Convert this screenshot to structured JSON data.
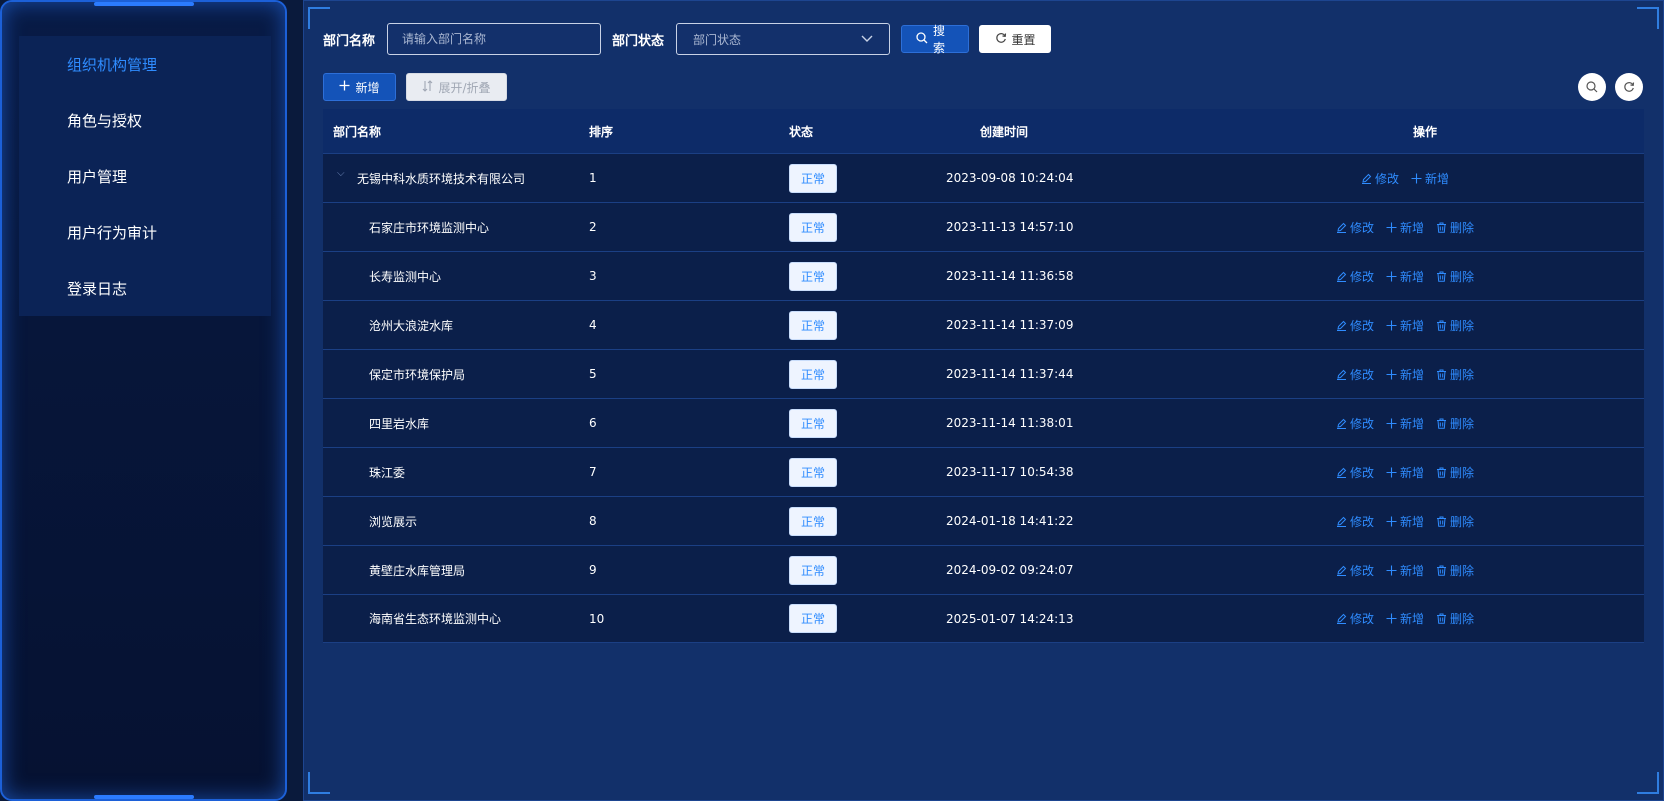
{
  "sidebar": {
    "items": [
      {
        "label": "组织机构管理",
        "active": true
      },
      {
        "label": "角色与授权",
        "active": false
      },
      {
        "label": "用户管理",
        "active": false
      },
      {
        "label": "用户行为审计",
        "active": false
      },
      {
        "label": "登录日志",
        "active": false
      }
    ]
  },
  "search": {
    "name_label": "部门名称",
    "name_placeholder": "请输入部门名称",
    "status_label": "部门状态",
    "status_placeholder": "部门状态",
    "search_label": "搜索",
    "reset_label": "重置"
  },
  "toolbar": {
    "add_label": "新增",
    "expand_label": "展开/折叠",
    "search_icon": "search-icon",
    "refresh_icon": "refresh-icon"
  },
  "table": {
    "headers": {
      "name": "部门名称",
      "sort": "排序",
      "status": "状态",
      "created": "创建时间",
      "ops": "操作"
    },
    "op_labels": {
      "edit": "修改",
      "add": "新增",
      "delete": "删除"
    },
    "rows": [
      {
        "name": "无锡中科水质环境技术有限公司",
        "sort": "1",
        "status": "正常",
        "created": "2023-09-08 10:24:04",
        "root": true
      },
      {
        "name": "石家庄市环境监测中心",
        "sort": "2",
        "status": "正常",
        "created": "2023-11-13 14:57:10"
      },
      {
        "name": "长寿监测中心",
        "sort": "3",
        "status": "正常",
        "created": "2023-11-14 11:36:58"
      },
      {
        "name": "沧州大浪淀水库",
        "sort": "4",
        "status": "正常",
        "created": "2023-11-14 11:37:09"
      },
      {
        "name": "保定市环境保护局",
        "sort": "5",
        "status": "正常",
        "created": "2023-11-14 11:37:44"
      },
      {
        "name": "四里岩水库",
        "sort": "6",
        "status": "正常",
        "created": "2023-11-14 11:38:01"
      },
      {
        "name": "珠江委",
        "sort": "7",
        "status": "正常",
        "created": "2023-11-17 10:54:38"
      },
      {
        "name": "浏览展示",
        "sort": "8",
        "status": "正常",
        "created": "2024-01-18 14:41:22"
      },
      {
        "name": "黄壁庄水库管理局",
        "sort": "9",
        "status": "正常",
        "created": "2024-09-02 09:24:07"
      },
      {
        "name": "海南省生态环境监测中心",
        "sort": "10",
        "status": "正常",
        "created": "2025-01-07 14:24:13"
      }
    ]
  },
  "colors": {
    "accent": "#2f8cff",
    "panel": "#12306a",
    "sidebar": "#081b46"
  }
}
